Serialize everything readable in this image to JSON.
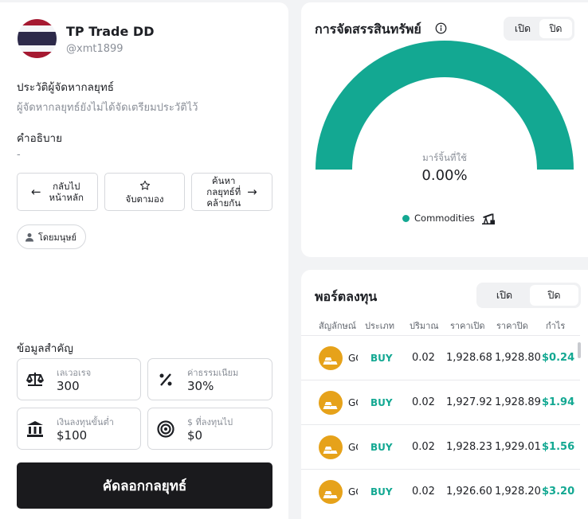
{
  "profile": {
    "name": "TP Trade DD",
    "handle": "@xmt1899",
    "history_title": "ประวัติผู้จัดหากลยุทธ์",
    "history_text": "ผู้จัดหากลยุทธ์ยังไม่ได้จัดเตรียมประวัติไว้",
    "description_title": "คำอธิบาย",
    "description_text": "-",
    "flag_colors": [
      "#A51931",
      "#F4F5F8",
      "#2D2A4A",
      "#F4F5F8",
      "#A51931"
    ]
  },
  "actions": {
    "back_label": "กลับไป\nหน้าหลัก",
    "watch_label": "จับตามอง",
    "similar_label": "ค้นหา\nกลยุทธ์ที่\nคล้ายกัน"
  },
  "chip": {
    "label": "โดยมนุษย์",
    "icon": "person-icon"
  },
  "key_info": {
    "title": "ข้อมูลสำคัญ",
    "leverage": {
      "label": "เลเวอเรจ",
      "value": "300",
      "icon": "scale-icon"
    },
    "fee": {
      "label": "ค่าธรรมเนียม",
      "value": "30%",
      "icon": "percent-icon"
    },
    "min_invest": {
      "label": "เงินลงทุนขั้นต่ำ",
      "value": "$100",
      "icon": "bank-icon"
    },
    "invested": {
      "label": "$ ที่ลงทุนไป",
      "value": "$0",
      "icon": "target-icon"
    }
  },
  "copy_button": "คัดลอกกลยุทธ์",
  "allocation": {
    "title": "การจัดสรรสินทรัพย์",
    "toggle_on": "เปิด",
    "toggle_off": "ปิด",
    "selected": "ปิด",
    "gauge_percent_label": "100%",
    "gauge_fill_fraction": 1.0,
    "margin_label": "มาร์จิ้นที่ใช้",
    "margin_value": "0.00%",
    "legend_label": "Commodities",
    "accent_color": "#13A892"
  },
  "portfolio": {
    "title": "พอร์ตลงทุน",
    "toggle_on": "เปิด",
    "toggle_off": "ปิด",
    "selected": "ปิด",
    "columns": [
      "สัญลักษณ์",
      "ประเภท",
      "ปริมาณ",
      "ราคาเปิด",
      "ราคาปิด",
      "กำไร"
    ],
    "rows": [
      {
        "symbol": "GOLD",
        "type": "BUY",
        "volume": "0.02",
        "open": "1,928.68",
        "close": "1,928.80",
        "profit": "$0.24"
      },
      {
        "symbol": "GOLD",
        "type": "BUY",
        "volume": "0.02",
        "open": "1,927.92",
        "close": "1,928.89",
        "profit": "$1.94"
      },
      {
        "symbol": "GOLD",
        "type": "BUY",
        "volume": "0.02",
        "open": "1,928.23",
        "close": "1,929.01",
        "profit": "$1.56"
      },
      {
        "symbol": "GOLD",
        "type": "BUY",
        "volume": "0.02",
        "open": "1,926.60",
        "close": "1,928.20",
        "profit": "$3.20"
      }
    ]
  }
}
